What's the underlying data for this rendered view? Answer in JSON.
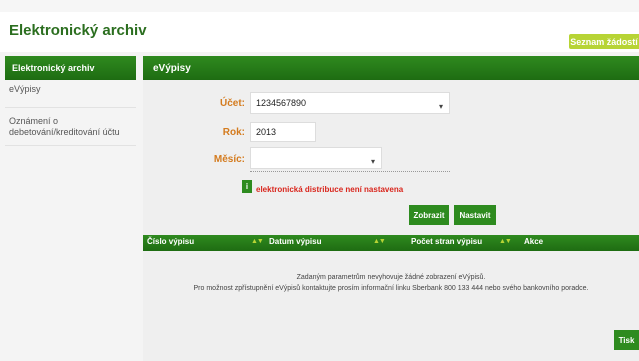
{
  "app": {
    "title": "Elektronický archiv",
    "top_button": "Seznam žádostí"
  },
  "sidebar": {
    "items": [
      {
        "label": "Elektronický archiv"
      },
      {
        "label": "eVýpisy"
      },
      {
        "label_line1": "Oznámení o",
        "label_line2": "debetování/kreditování účtu"
      }
    ]
  },
  "main": {
    "header": "eVýpisy",
    "form": {
      "account_label": "Účet:",
      "account_value": "1234567890",
      "year_label": "Rok:",
      "year_value": "2013",
      "month_label": "Měsíc:",
      "month_value": ""
    },
    "info_badge": "i",
    "warning": "elektronická distribuce není nastavena",
    "buttons": {
      "show": "Zobrazit",
      "set": "Nastavit",
      "print": "Tisk"
    },
    "table": {
      "columns": [
        "Číslo výpisu",
        "Datum výpisu",
        "Počet stran výpisu",
        "Akce"
      ],
      "sort_glyph": "▲▼",
      "empty_line1": "Zadaným parametrům nevyhovuje žádné zobrazení eVýpisů.",
      "empty_line2": "Pro možnost zpřístupnění eVýpisů kontaktujte prosím informační linku Sberbank 800 133 444 nebo svého bankovního poradce."
    }
  },
  "colors": {
    "brand_green": "#2e8b1f",
    "accent_lime": "#b7d435",
    "label_orange": "#d47b1e",
    "warning_red": "#d9251c"
  }
}
